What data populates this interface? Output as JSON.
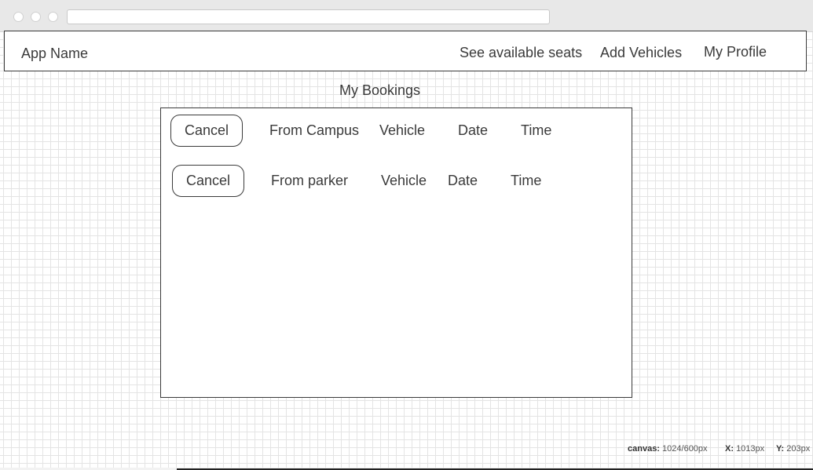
{
  "navbar": {
    "app_name": "App Name",
    "links": [
      "See available seats",
      "Add Vehicles",
      "My Profile"
    ]
  },
  "page_title": "My Bookings",
  "bookings": [
    {
      "action": "Cancel",
      "route": "From Campus",
      "vehicle": "Vehicle",
      "date": "Date",
      "time": "Time"
    },
    {
      "action": "Cancel",
      "route": "From parker",
      "vehicle": "Vehicle",
      "date": "Date",
      "time": "Time"
    }
  ],
  "status_bar": {
    "canvas_label": "canvas:",
    "canvas_value": "1024/600px",
    "x_label": "X:",
    "x_value": "1013px",
    "y_label": "Y:",
    "y_value": "203px"
  }
}
